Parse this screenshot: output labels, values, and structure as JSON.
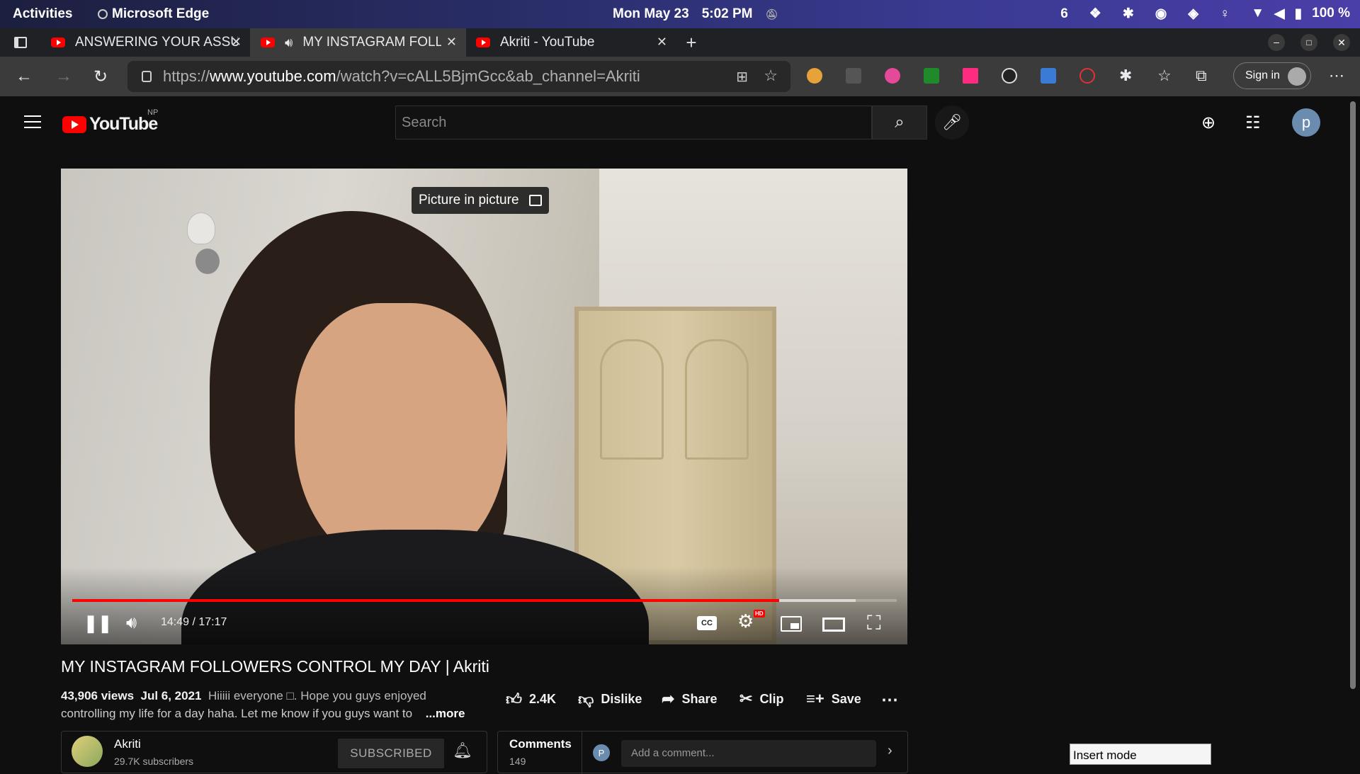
{
  "system_bar": {
    "activities": "Activities",
    "app_name": "Microsoft Edge",
    "date": "Mon May 23",
    "time": "5:02 PM",
    "workspace": "6",
    "battery": "100 %"
  },
  "tabs": [
    {
      "title": "ANSWERING YOUR ASSU",
      "active": false
    },
    {
      "title": "MY INSTAGRAM FOLL",
      "active": true
    },
    {
      "title": "Akriti - YouTube",
      "active": false
    }
  ],
  "address_bar": {
    "url_prefix": "https://",
    "url_host": "www.youtube.com",
    "url_path": "/watch?v=cALL5BjmGcc&ab_channel=Akriti",
    "signin_label": "Sign in"
  },
  "youtube_header": {
    "logo_text": "YouTube",
    "region": "NP",
    "search_placeholder": "Search",
    "avatar_letter": "p"
  },
  "player": {
    "pip_tooltip": "Picture in picture",
    "current_time": "14:49",
    "duration": "17:17",
    "time_display": "14:49 / 17:17",
    "played_fraction": 0.857,
    "buffered_fraction": 0.95,
    "cc_label": "CC",
    "hd_badge": "HD"
  },
  "video": {
    "title": "MY INSTAGRAM FOLLOWERS CONTROL MY DAY | Akriti",
    "views": "43,906 views",
    "date": "Jul 6, 2021",
    "description_line1": "Hiiiii everyone □. Hope you guys enjoyed",
    "description_line2": "controlling my life for a day haha. Let me know if you guys want to",
    "more_label": "...more"
  },
  "actions": {
    "like_count": "2.4K",
    "dislike_label": "Dislike",
    "share_label": "Share",
    "clip_label": "Clip",
    "save_label": "Save"
  },
  "channel": {
    "name": "Akriti",
    "subscribers": "29.7K subscribers",
    "subscribed_label": "SUBSCRIBED"
  },
  "comments": {
    "header": "Comments",
    "count": "149",
    "avatar_letter": "P",
    "placeholder": "Add a comment..."
  },
  "status": {
    "insert_mode": "Insert mode"
  }
}
